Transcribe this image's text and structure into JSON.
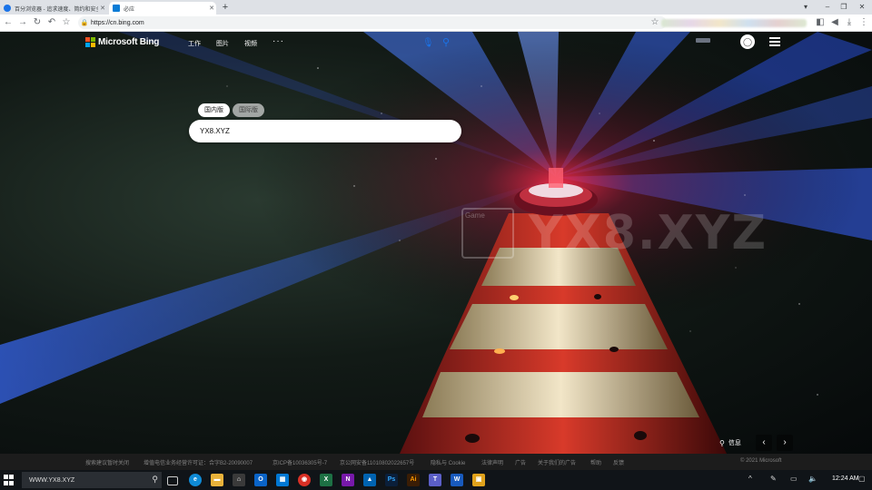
{
  "browser": {
    "tabs": [
      {
        "label": "百分浏览器 - 追求速度、简约和安全",
        "icon_color": "#1a73e8",
        "close": "✕"
      },
      {
        "label": "必应",
        "icon_color": "#0a7cd6",
        "close": "✕"
      }
    ],
    "new_tab": "+",
    "window_controls": [
      "▾",
      "–",
      "❐",
      "✕"
    ],
    "nav": {
      "back": "←",
      "forward": "→",
      "reload": "↻",
      "home_star": "☆"
    },
    "address": "https://cn.bing.com",
    "right_icons": [
      "☆",
      "⟲",
      "◧",
      "◀",
      "⤓",
      "⋮"
    ]
  },
  "bing": {
    "brand": "Microsoft Bing",
    "logo_colors": [
      "#f25022",
      "#7fba00",
      "#00a4ef",
      "#ffb900"
    ],
    "nav": [
      "工作",
      "图片",
      "视频"
    ],
    "nav_more": "···",
    "scope_tabs": [
      "国内版",
      "国际版"
    ],
    "search_value": "YX8.XYZ",
    "watermark": "YX8.XYZ",
    "watermark_logo": "Game",
    "info_label": "信息",
    "prev": "‹",
    "next": "›"
  },
  "footer": {
    "links": [
      "搜索建议暂时关闭",
      "增值电信业务经营许可证：合字B2-20090007",
      "京ICP备10036305号-7",
      "京公网安备11010802022657号",
      "隐私与 Cookie",
      "法律声明",
      "广告",
      "关于我们的广告",
      "帮助",
      "反馈"
    ],
    "copyright": "© 2021 Microsoft"
  },
  "taskbar": {
    "search_value": "WWW.YX8.XYZ",
    "apps": [
      {
        "name": "task-view",
        "glyph": "▭",
        "color": "transparent"
      },
      {
        "name": "edge",
        "glyph": "e",
        "color": "#0f8bd6"
      },
      {
        "name": "file-explorer",
        "glyph": "▬",
        "color": "#e8b23a"
      },
      {
        "name": "store",
        "glyph": "⌂",
        "color": "#3a3a3a"
      },
      {
        "name": "outlook",
        "glyph": "O",
        "color": "#0a64c8"
      },
      {
        "name": "calendar",
        "glyph": "▦",
        "color": "#0078d4"
      },
      {
        "name": "chrome-red",
        "glyph": "◉",
        "color": "#d93025"
      },
      {
        "name": "excel",
        "glyph": "X",
        "color": "#1d7044"
      },
      {
        "name": "onenote",
        "glyph": "N",
        "color": "#7719aa"
      },
      {
        "name": "photos",
        "glyph": "▲",
        "color": "#0063b1"
      },
      {
        "name": "photoshop",
        "glyph": "Ps",
        "color": "#0b1f3a"
      },
      {
        "name": "illustrator",
        "glyph": "Ai",
        "color": "#3a1d05"
      },
      {
        "name": "teams",
        "glyph": "T",
        "color": "#5b5fc7"
      },
      {
        "name": "word",
        "glyph": "W",
        "color": "#185abd"
      },
      {
        "name": "image-app",
        "glyph": "▣",
        "color": "#e0a21c"
      }
    ],
    "tray": [
      "^",
      "✎",
      "▭",
      "🔈"
    ],
    "clock": "12:24 AM",
    "notifications": "▢"
  }
}
